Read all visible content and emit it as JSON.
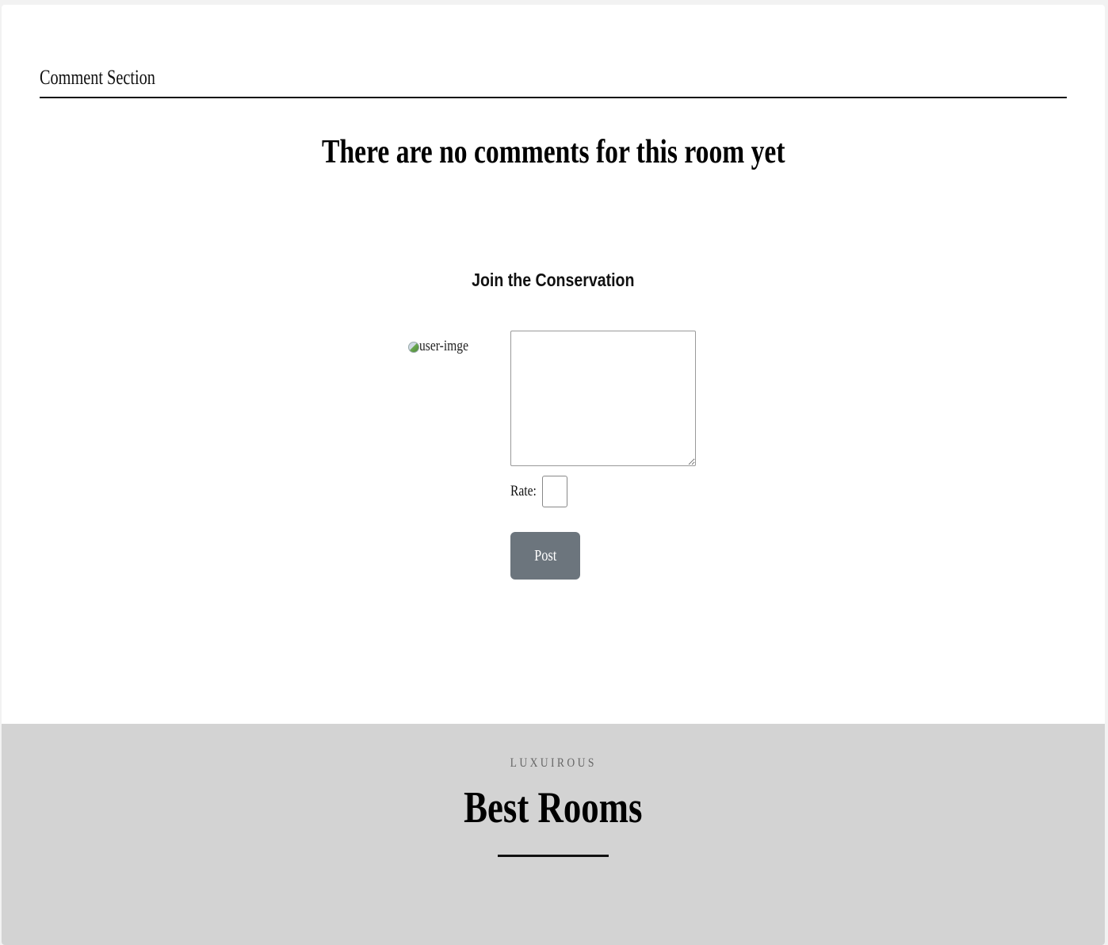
{
  "comments": {
    "section_title": "Comment Section",
    "empty_message": "There are no comments for this room yet"
  },
  "join": {
    "title": "Join the Conservation",
    "user_image_alt": "user-imge",
    "comment_value": "",
    "rate_label": "Rate:",
    "rate_value": "",
    "post_label": "Post",
    "post_color": "#6c757d"
  },
  "footer": {
    "kicker": "LUXUIROUS",
    "title": "Best Rooms",
    "background": "#d3d3d3"
  }
}
